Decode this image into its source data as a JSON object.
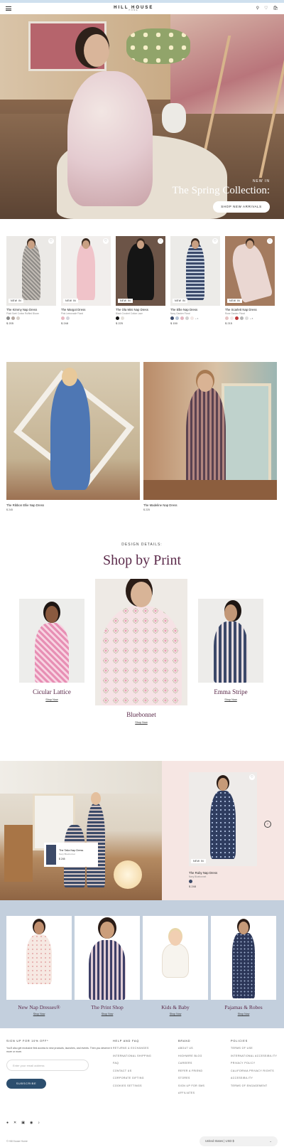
{
  "header": {
    "brand_line1": "HILL HOUSE",
    "brand_line2": "HOME",
    "icons": [
      "menu-icon",
      "search-icon",
      "heart-icon",
      "bag-icon"
    ]
  },
  "hero": {
    "tag": "NEW IN",
    "headline": "The Spring Collection:",
    "button": "SHOP NEW ARRIVALS"
  },
  "products": [
    {
      "badge": "NEW IN",
      "name": "The Kimmy Nap Dress",
      "sub": "Plaid Swirl Cotton Ruffled Bloom",
      "price": "$ 205",
      "swatches": [
        "#8a8a8a",
        "#b5a8a0",
        "#d8d1cb"
      ],
      "more": ""
    },
    {
      "badge": "NEW IN",
      "name": "The Margot Dress",
      "sub": "Pink Lemonade Floral",
      "price": "$ 248",
      "swatches": [
        "#e7b9c2",
        "#d4d4dc"
      ],
      "more": ""
    },
    {
      "badge": "NEW IN",
      "name": "The Ola Mini Nap Dress",
      "sub": "Black Crochet Cotton Lace",
      "price": "$ 225",
      "swatches": [
        "#111111",
        "#e4e0da"
      ],
      "more": ""
    },
    {
      "badge": "NEW IN",
      "name": "The Ellie Nap Dress",
      "sub": "Navy Garden Floral",
      "price": "$ 150",
      "swatches": [
        "#3b4a6b",
        "#b7c5d8",
        "#e3b6c0",
        "#d0d0d0",
        "#f2e7e4"
      ],
      "more": "+ 6"
    },
    {
      "badge": "NEW IN",
      "name": "The Scarlett Nap Dress",
      "sub": "Rose Garden Floral",
      "price": "$ 215",
      "swatches": [
        "#e5c4c4",
        "#f3e8e8",
        "#c0383a",
        "#b5b5b5",
        "#dedede"
      ],
      "more": "+ 8"
    }
  ],
  "duo": [
    {
      "name": "The Ribbon Ellie Nap Dress",
      "price": "$ 245"
    },
    {
      "name": "The Madeline Nap Dress",
      "price": "$ 225"
    }
  ],
  "prints": {
    "eyebrow": "DESIGN DETAILS:",
    "title": "Shop by Print",
    "items": [
      {
        "name": "Cicular Lattice",
        "link": "Shop Now"
      },
      {
        "name": "Bluebonnet",
        "link": "Shop Now"
      },
      {
        "name": "Emma Stripe",
        "link": "Shop Now"
      }
    ]
  },
  "ruby": {
    "hotspot": {
      "name": "The Talia Nap Dress",
      "sub": "Navy Bluebonnet",
      "price": "$ 245"
    },
    "product": {
      "badge": "NEW IN",
      "name": "The Ruby Nap Dress",
      "sub": "Navy Bluebonnet",
      "price": "$ 248",
      "swatch": "#3c4a68"
    }
  },
  "categories": [
    {
      "name": "New Nap Dresses®",
      "link": "Shop Now"
    },
    {
      "name": "The Print Shop",
      "link": "Shop Now"
    },
    {
      "name": "Kids & Baby",
      "link": "Shop Now"
    },
    {
      "name": "Pajamas & Robes",
      "link": "Shop Now"
    }
  ],
  "footer": {
    "signup_title": "SIGN UP FOR 10% OFF*",
    "signup_text": "You'll also get exclusive first access to new products, launches, and events. Then you deserve it more or more.",
    "email_placeholder": "Enter your email address",
    "subscribe": "SUBSCRIBE",
    "help_title": "HELP AND FAQ",
    "help_links": [
      "RETURNS & EXCHANGES",
      "INTERNATIONAL SHIPPING",
      "FAQ",
      "CONTACT US",
      "CORPORATE GIFTING",
      "COOKIES SETTINGS"
    ],
    "brand_title": "BRAND",
    "brand_links": [
      "ABOUT US",
      "HIGHWIRE BLOG",
      "CAREERS",
      "REFER A FRIEND",
      "STORES",
      "SIGN UP FOR SMS",
      "AFFILIATES"
    ],
    "policies_title": "POLICIES",
    "policies_links": [
      "TERMS OF USE",
      "INTERNATIONAL ACCESSIBILITY",
      "PRIVACY POLICY",
      "CALIFORNIA PRIVACY RIGHTS",
      "ACCESSIBILITY",
      "TERMS OF ENGAGEMENT"
    ],
    "social_icons": [
      "facebook-icon",
      "x-icon",
      "instagram-icon",
      "pinterest-icon",
      "tiktok-icon"
    ],
    "copyright": "© Hill House Home",
    "locale": "United States | USD $"
  }
}
